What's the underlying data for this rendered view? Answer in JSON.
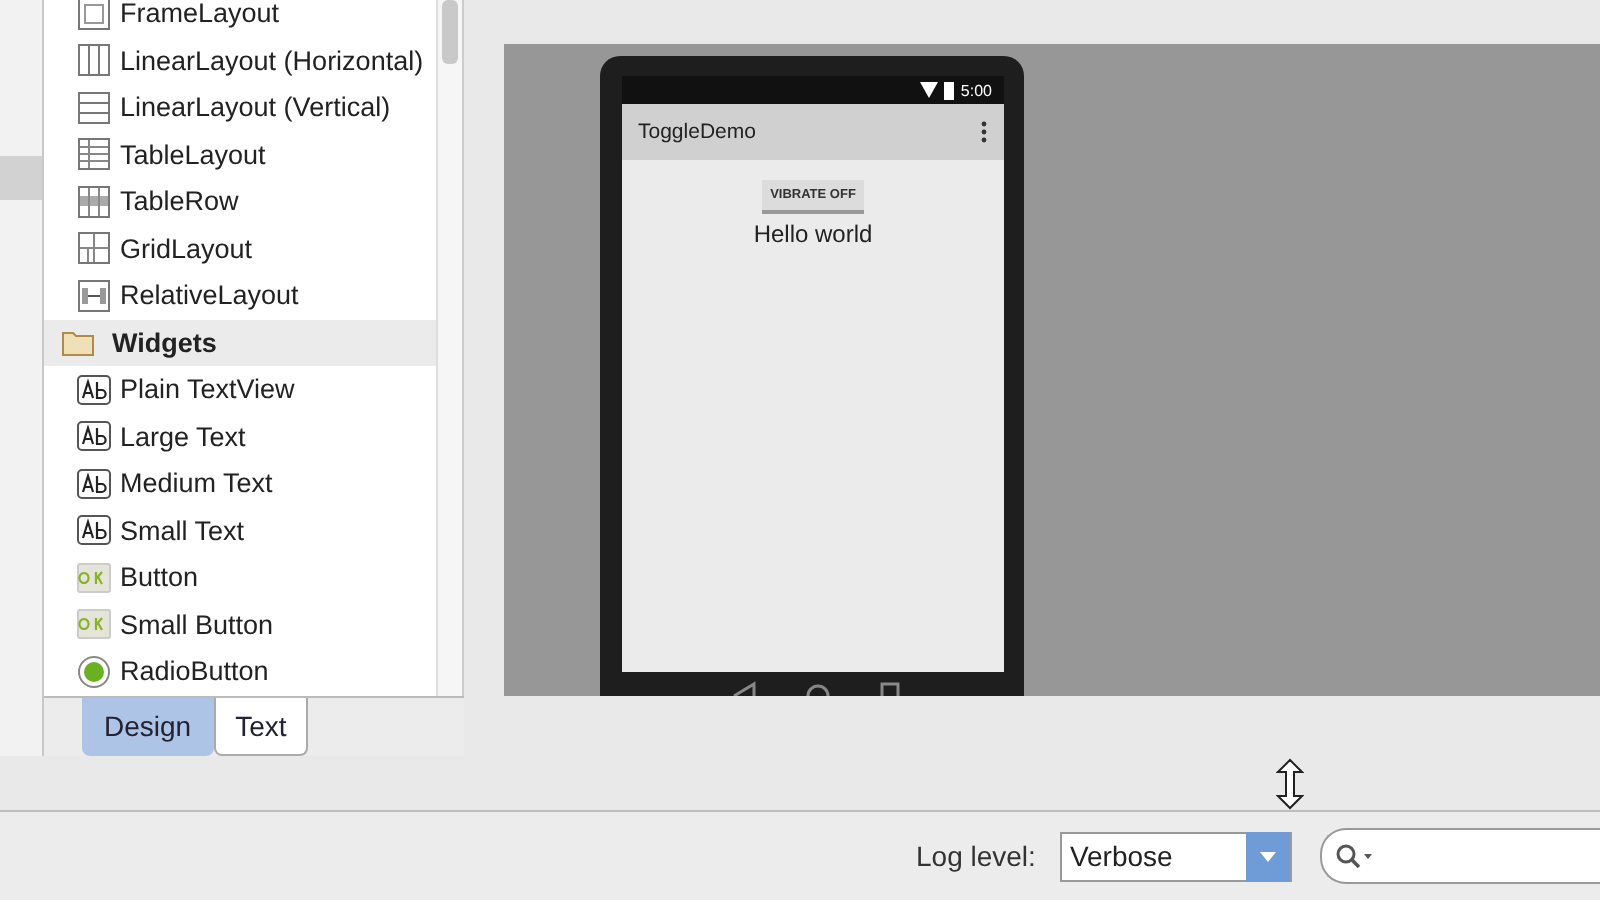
{
  "palette": {
    "items": [
      {
        "label": "FrameLayout",
        "kind": "frame"
      },
      {
        "label": "LinearLayout (Horizontal)",
        "kind": "linear_horizontal"
      },
      {
        "label": "LinearLayout (Vertical)",
        "kind": "linear_vertical"
      },
      {
        "label": "TableLayout",
        "kind": "table"
      },
      {
        "label": "TableRow",
        "kind": "table_row"
      },
      {
        "label": "GridLayout",
        "kind": "grid"
      },
      {
        "label": "RelativeLayout",
        "kind": "relative"
      },
      {
        "label": "Widgets",
        "kind": "category"
      },
      {
        "label": "Plain TextView",
        "kind": "text"
      },
      {
        "label": "Large Text",
        "kind": "text"
      },
      {
        "label": "Medium Text",
        "kind": "text"
      },
      {
        "label": "Small Text",
        "kind": "text"
      },
      {
        "label": "Button",
        "kind": "button"
      },
      {
        "label": "Small Button",
        "kind": "button"
      },
      {
        "label": "RadioButton",
        "kind": "radio"
      }
    ]
  },
  "preview": {
    "status_time": "5:00",
    "app_title": "ToggleDemo",
    "button": "VIBRATE OFF",
    "text": "Hello world"
  },
  "editor_tabs": [
    {
      "label": "Design",
      "selected": true
    },
    {
      "label": "Text",
      "selected": false
    }
  ],
  "logcat": {
    "log_level_label": "Log level:",
    "log_level": "Verbose"
  }
}
